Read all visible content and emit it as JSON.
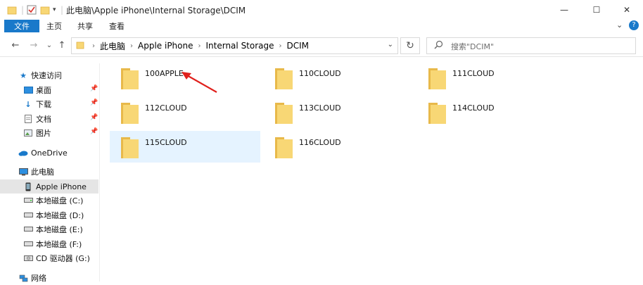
{
  "window": {
    "title": "此电脑\\Apple iPhone\\Internal Storage\\DCIM",
    "minimize_label": "—",
    "maximize_label": "☐",
    "close_label": "✕"
  },
  "ribbon": {
    "file": "文件",
    "home": "主页",
    "share": "共享",
    "view": "查看",
    "collapse": "⌄",
    "help": "?"
  },
  "nav": {
    "back": "←",
    "forward": "→",
    "recent": "⌄",
    "up": "↑",
    "breadcrumbs": [
      "此电脑",
      "Apple iPhone",
      "Internal Storage",
      "DCIM"
    ],
    "address_dropdown": "⌄",
    "refresh": "↻",
    "search_placeholder": "搜索\"DCIM\""
  },
  "sidebar": {
    "items": [
      {
        "label": "快速访问",
        "icon": "star-icon"
      },
      {
        "label": "桌面",
        "icon": "desktop-icon",
        "pinned": true
      },
      {
        "label": "下载",
        "icon": "download-icon",
        "pinned": true
      },
      {
        "label": "文档",
        "icon": "document-icon",
        "pinned": true
      },
      {
        "label": "图片",
        "icon": "pictures-icon",
        "pinned": true
      },
      {
        "label": "OneDrive",
        "icon": "cloud-icon"
      },
      {
        "label": "此电脑",
        "icon": "computer-icon"
      },
      {
        "label": "Apple iPhone",
        "icon": "phone-icon",
        "selected": true
      },
      {
        "label": "本地磁盘 (C:)",
        "icon": "drive-icon"
      },
      {
        "label": "本地磁盘 (D:)",
        "icon": "drive-icon"
      },
      {
        "label": "本地磁盘 (E:)",
        "icon": "drive-icon"
      },
      {
        "label": "本地磁盘 (F:)",
        "icon": "drive-icon"
      },
      {
        "label": "CD 驱动器 (G:)",
        "icon": "cd-drive-icon"
      },
      {
        "label": "网络",
        "icon": "network-icon"
      }
    ]
  },
  "folders": [
    {
      "name": "100APPLE"
    },
    {
      "name": "110CLOUD"
    },
    {
      "name": "111CLOUD"
    },
    {
      "name": "112CLOUD"
    },
    {
      "name": "113CLOUD"
    },
    {
      "name": "114CLOUD"
    },
    {
      "name": "115CLOUD",
      "selected": true
    },
    {
      "name": "116CLOUD"
    }
  ],
  "colors": {
    "accent": "#1979ca",
    "folder": "#f8d775",
    "folder_dark": "#e8b94a",
    "selection": "#e5f3ff",
    "annotation_arrow": "#e0201c"
  }
}
